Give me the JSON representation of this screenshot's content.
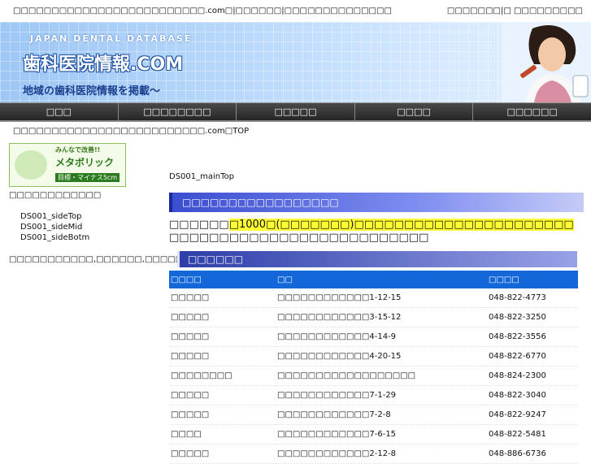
{
  "topbar": {
    "left": "□□□□□□□□□□□□□□□□□□□□□□□□□.com□|□□□□□□|□□□□□□□□□□□□□□",
    "right": "□□□□□□□|□ □□□□□□□□□"
  },
  "banner": {
    "sub": "JAPAN DENTAL DATABASE",
    "title": "歯科医院情報.COM",
    "tagline": "地域の歯科医院情報を掲載〜"
  },
  "nav": [
    "□□□",
    "□□□□□□□□",
    "□□□□□",
    "□□□□",
    "□□□□□□"
  ],
  "breadcrumb": "□□□□□□□□□□□□□□□□□□□□□□□□□.com□TOP",
  "side": {
    "banner": {
      "t1": "みんなで改善!!",
      "t2": "メタボリック",
      "t3": "目標・マイナス5cm"
    },
    "heading": "□□□□□□□□□□□□",
    "items": [
      "DS001_sideTop",
      "DS001_sideMid",
      "DS001_sideBotm"
    ],
    "note": "□□□□□□□□□□□,□□□□□□,□□□□□□□□□□□□□□□□□□□□□□□□□.com"
  },
  "main": {
    "top": "DS001_mainTop",
    "section": "□□□□□□□□□□□□□□□□□",
    "intro_pre": "□□□□□□",
    "intro_hl": "□1000□(□□□□□□□)□□□□□□□□□□□□□□□□□□□□□□",
    "intro_post": " □□□□□□□□□□□□□□□□□□□□□□□□□□",
    "subheading": "□□□□□□",
    "columns": [
      "□□□□",
      "□□",
      "□□□□"
    ],
    "rows": [
      [
        "□□□□□",
        "□□□□□□□□□□□□1-12-15",
        "048-822-4773"
      ],
      [
        "□□□□□",
        "□□□□□□□□□□□□3-15-12",
        "048-822-3250"
      ],
      [
        "□□□□□",
        "□□□□□□□□□□□□4-14-9",
        "048-822-3556"
      ],
      [
        "□□□□□",
        "□□□□□□□□□□□□4-20-15",
        "048-822-6770"
      ],
      [
        "□□□□□□□□",
        "□□□□□□□□□□□□□□□□□□",
        "048-824-2300"
      ],
      [
        "□□□□□",
        "□□□□□□□□□□□□7-1-29",
        "048-822-3040"
      ],
      [
        "□□□□□",
        "□□□□□□□□□□□□7-2-8",
        "048-822-9247"
      ],
      [
        "□□□□",
        "□□□□□□□□□□□□7-6-15",
        "048-822-5481"
      ],
      [
        "□□□□□",
        "□□□□□□□□□□□□2-12-8",
        "048-886-6736"
      ]
    ]
  }
}
